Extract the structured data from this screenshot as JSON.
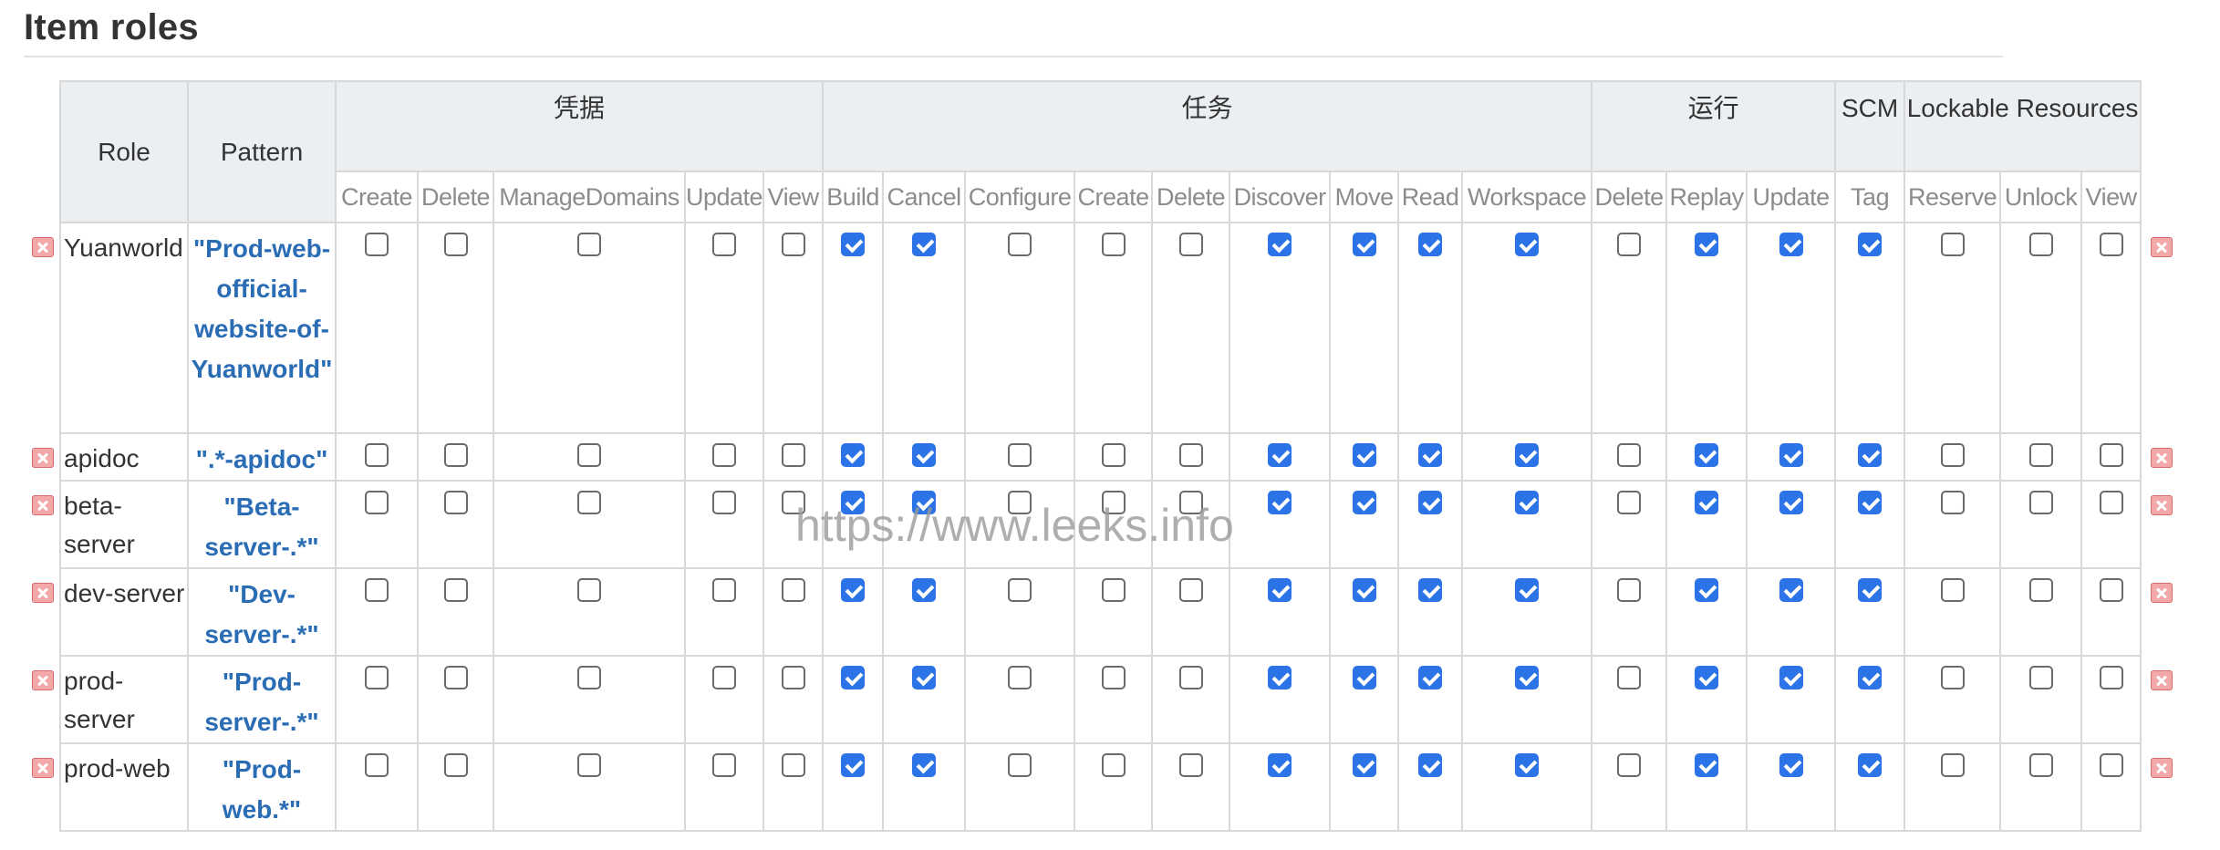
{
  "title": "Item roles",
  "watermark": "https://www.leeks.info",
  "headers": {
    "role": "Role",
    "pattern": "Pattern",
    "groups": [
      "凭据",
      "任务",
      "运行",
      "SCM",
      "Lockable Resources"
    ]
  },
  "permissions": [
    "Create",
    "Delete",
    "ManageDomains",
    "Update",
    "View",
    "Build",
    "Cancel",
    "Configure",
    "Create",
    "Delete",
    "Discover",
    "Move",
    "Read",
    "Workspace",
    "Delete",
    "Replay",
    "Update",
    "Tag",
    "Reserve",
    "Unlock",
    "View"
  ],
  "rows": [
    {
      "role": "Yuanworld",
      "pattern": "\"Prod-web-official-website-of-Yuanworld\"",
      "checks": [
        false,
        false,
        false,
        false,
        false,
        true,
        true,
        false,
        false,
        false,
        true,
        true,
        true,
        true,
        false,
        true,
        true,
        true,
        false,
        false,
        false
      ]
    },
    {
      "role": "apidoc",
      "pattern": "\".*-apidoc\"",
      "checks": [
        false,
        false,
        false,
        false,
        false,
        true,
        true,
        false,
        false,
        false,
        true,
        true,
        true,
        true,
        false,
        true,
        true,
        true,
        false,
        false,
        false
      ]
    },
    {
      "role": "beta-server",
      "pattern": "\"Beta-server-.*\"",
      "checks": [
        false,
        false,
        false,
        false,
        false,
        true,
        true,
        false,
        false,
        false,
        true,
        true,
        true,
        true,
        false,
        true,
        true,
        true,
        false,
        false,
        false
      ]
    },
    {
      "role": "dev-server",
      "pattern": "\"Dev-server-.*\"",
      "checks": [
        false,
        false,
        false,
        false,
        false,
        true,
        true,
        false,
        false,
        false,
        true,
        true,
        true,
        true,
        false,
        true,
        true,
        true,
        false,
        false,
        false
      ]
    },
    {
      "role": "prod-server",
      "pattern": "\"Prod-server-.*\"",
      "checks": [
        false,
        false,
        false,
        false,
        false,
        true,
        true,
        false,
        false,
        false,
        true,
        true,
        true,
        true,
        false,
        true,
        true,
        true,
        false,
        false,
        false
      ]
    },
    {
      "role": "prod-web",
      "pattern": "\"Prod-web.*\"",
      "checks": [
        false,
        false,
        false,
        false,
        false,
        true,
        true,
        false,
        false,
        false,
        true,
        true,
        true,
        true,
        false,
        true,
        true,
        true,
        false,
        false,
        false
      ]
    }
  ],
  "colors": {
    "accent": "#2b73e6",
    "pattern_text": "#2a6db4",
    "header_bg": "#eceff2",
    "delete_icon": "#f3a9a9"
  }
}
